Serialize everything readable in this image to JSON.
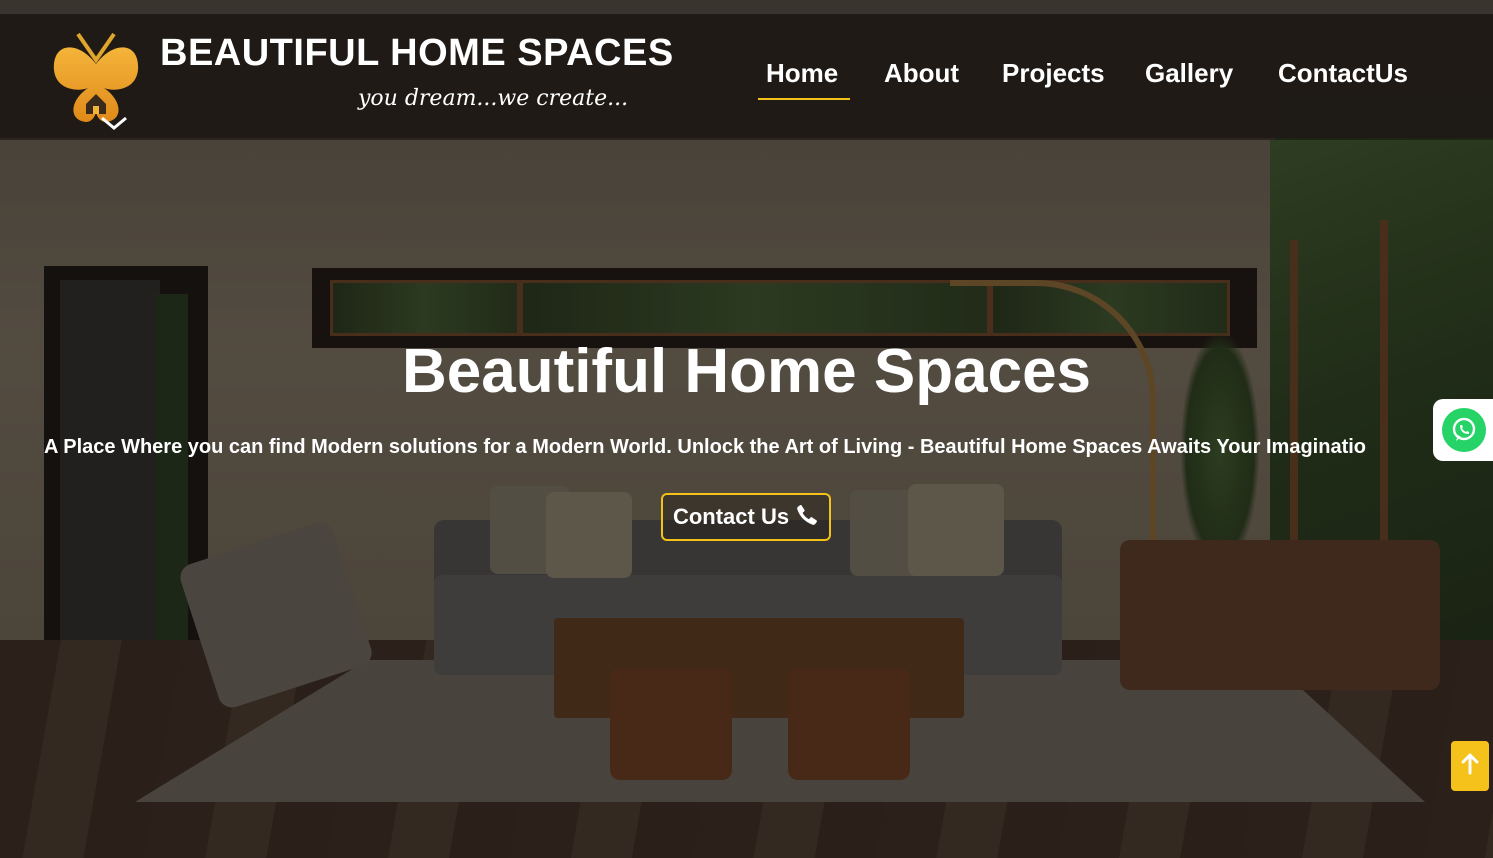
{
  "brand": {
    "title": "BEAUTIFUL HOME SPACES",
    "tagline": "you dream...we create...",
    "accent_color": "#f2c218",
    "logo_icon": "butterfly-house-logo"
  },
  "nav": {
    "items": [
      {
        "label": "Home",
        "active": true
      },
      {
        "label": "About",
        "active": false
      },
      {
        "label": "Projects",
        "active": false
      },
      {
        "label": "Gallery",
        "active": false
      },
      {
        "label": "ContactUs",
        "active": false
      }
    ]
  },
  "hero": {
    "title": "Beautiful Home Spaces",
    "subtitle": "A Place Where you can find Modern solutions for a Modern World. Unlock the Art of Living - Beautiful Home Spaces Awaits Your Imaginatio",
    "cta": {
      "label": "Contact Us",
      "icon": "phone-icon"
    }
  },
  "floating": {
    "whatsapp": {
      "icon": "whatsapp-icon",
      "color": "#25d366"
    },
    "scroll_top": {
      "icon": "arrow-up-icon",
      "color": "#f5c21b"
    }
  }
}
